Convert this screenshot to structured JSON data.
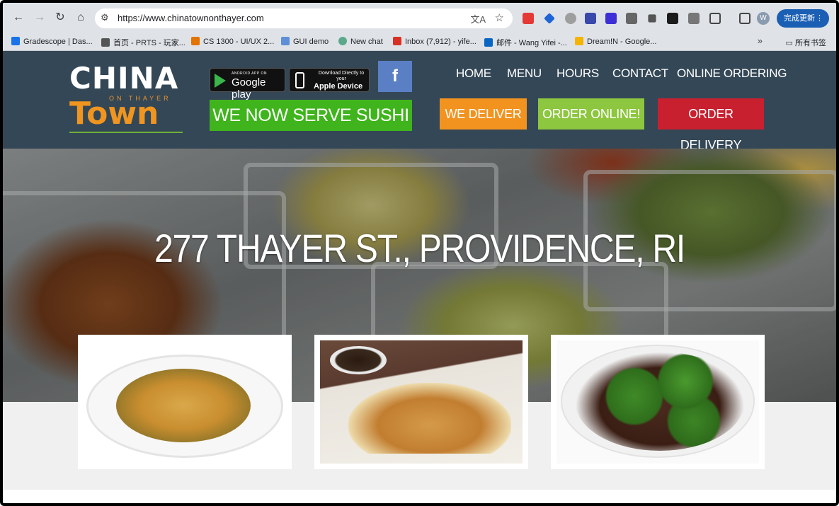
{
  "browser": {
    "url": "https://www.chinatownonthayer.com",
    "update_label": "完成更新",
    "profile_initial": "W",
    "bookmarks": [
      {
        "label": "Gradescope | Das...",
        "color": "#1a73e8"
      },
      {
        "label": "首页 - PRTS - 玩家...",
        "color": "#555555"
      },
      {
        "label": "CS 1300 - UI/UX 2...",
        "color": "#e37400"
      },
      {
        "label": "GUI demo",
        "color": "#5f8fd6"
      },
      {
        "label": "New chat",
        "color": "#5aa98a"
      },
      {
        "label": "Inbox (7,912) - yife...",
        "color": "#d93025"
      },
      {
        "label": "邮件 - Wang Yifei -...",
        "color": "#0a66c2"
      },
      {
        "label": "Dream!N - Google...",
        "color": "#f4b400"
      }
    ],
    "bookmarks_more": "»",
    "bookmarks_folder": "所有书签"
  },
  "site": {
    "logo": {
      "china": "CHINA",
      "on_thayer": "ON THAYER",
      "town": "Town"
    },
    "google_play": {
      "small": "ANDROID APP ON",
      "big": "Google play"
    },
    "apple": {
      "small": "Download Directly to your",
      "big": "Apple Device"
    },
    "facebook": "f",
    "sushi_banner": "WE NOW SERVE SUSHI",
    "nav": [
      "HOME",
      "MENU",
      "HOURS",
      "CONTACT",
      "ONLINE ORDERING"
    ],
    "cta": {
      "deliver": "WE DELIVER",
      "order_online": "ORDER ONLINE!",
      "order_delivery": "ORDER DELIVERY"
    },
    "hero_address": "277 THAYER ST., PROVIDENCE, RI"
  },
  "colors": {
    "header_bg": "#344756",
    "sushi_green": "#3fb41c",
    "deliver_orange": "#f29320",
    "online_green": "#8dc63f",
    "delivery_red": "#c8202f",
    "facebook_blue": "#5a7fc4"
  }
}
